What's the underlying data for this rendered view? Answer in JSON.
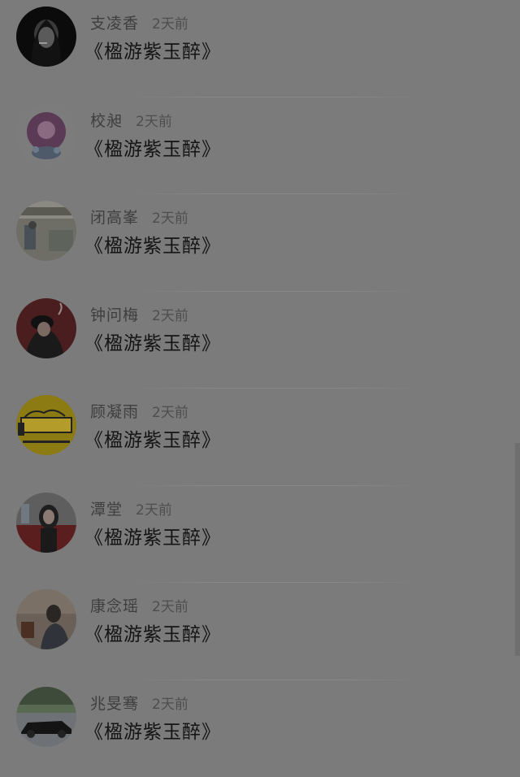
{
  "items": [
    {
      "name": "支凌香",
      "time": "2天前",
      "title": "《楹游紫玉醉》",
      "avatar": "avatar-girl-dark"
    },
    {
      "name": "校昶",
      "time": "2天前",
      "title": "《楹游紫玉醉》",
      "avatar": "avatar-anime-purple"
    },
    {
      "name": "闭高峯",
      "time": "2天前",
      "title": "《楹游紫玉醉》",
      "avatar": "avatar-street-photo"
    },
    {
      "name": "钟问梅",
      "time": "2天前",
      "title": "《楹游紫玉醉》",
      "avatar": "avatar-red-smoke"
    },
    {
      "name": "顾凝雨",
      "time": "2天前",
      "title": "《楹游紫玉醉》",
      "avatar": "avatar-yellow-illustration"
    },
    {
      "name": "潭堂",
      "time": "2天前",
      "title": "《楹游紫玉醉》",
      "avatar": "avatar-girl-red"
    },
    {
      "name": "康念瑶",
      "time": "2天前",
      "title": "《楹游紫玉醉》",
      "avatar": "avatar-man-cafe"
    },
    {
      "name": "兆旻骞",
      "time": "2天前",
      "title": "《楹游紫玉醉》",
      "avatar": "avatar-car"
    }
  ],
  "colors": {
    "overlay_background": "#7b7b7b",
    "name_text": "#3e3e3e",
    "title_text": "#141414"
  }
}
